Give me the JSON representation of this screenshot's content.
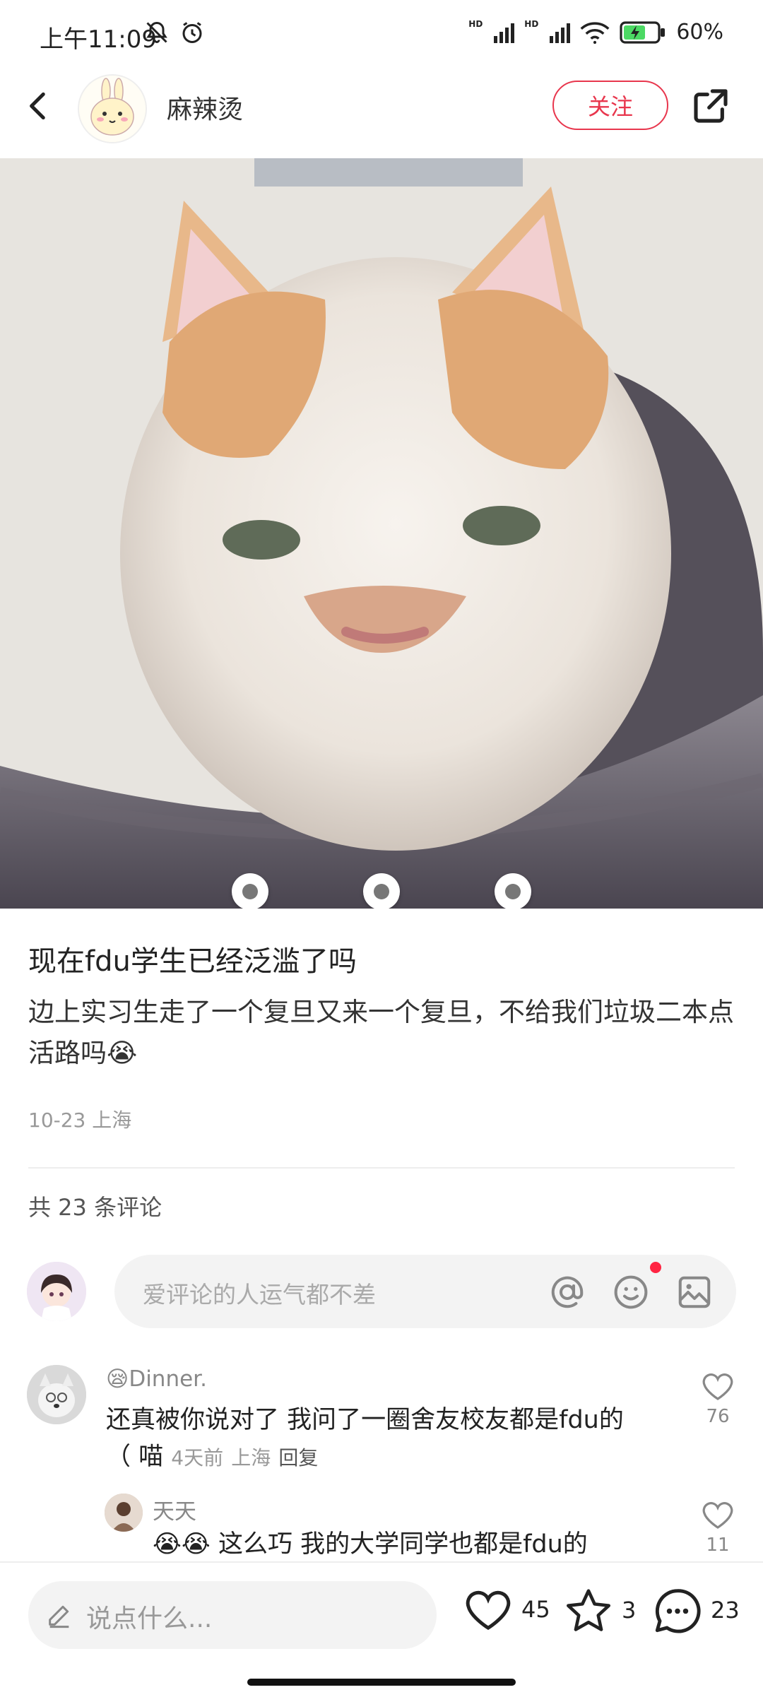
{
  "status_bar": {
    "time": "上午11:09",
    "battery": "60%",
    "hd1": "HD",
    "hd2": "HD"
  },
  "header": {
    "author_name": "麻辣烫",
    "follow_label": "关注"
  },
  "post": {
    "title": "现在fdu学生已经泛滥了吗",
    "body": "边上实习生走了一个复旦又来一个复旦，不给我们垃圾二本点活路吗",
    "body_emoji": "😭",
    "meta": "10-23 上海",
    "comment_count_text": "共 23 条评论"
  },
  "comment_input": {
    "placeholder": "爱评论的人运气都不差"
  },
  "comments": [
    {
      "name": "Dinner.",
      "name_emoji": "😪",
      "text_line1": "还真被你说对了 我问了一圈舍友校友都是fdu的",
      "text_line2": "（ 喵",
      "time": "4天前",
      "location": "上海",
      "reply_label": "回复",
      "likes": "76"
    },
    {
      "name": "天天",
      "text_emoji": "😭😭",
      "text": "这么巧 我的大学同学也都是fdu的",
      "likes": "11"
    }
  ],
  "bottom_bar": {
    "say_placeholder": "说点什么...",
    "like_count": "45",
    "star_count": "3",
    "comment_count": "23"
  },
  "colors": {
    "accent": "#e8364d",
    "notification": "#ff2442"
  }
}
